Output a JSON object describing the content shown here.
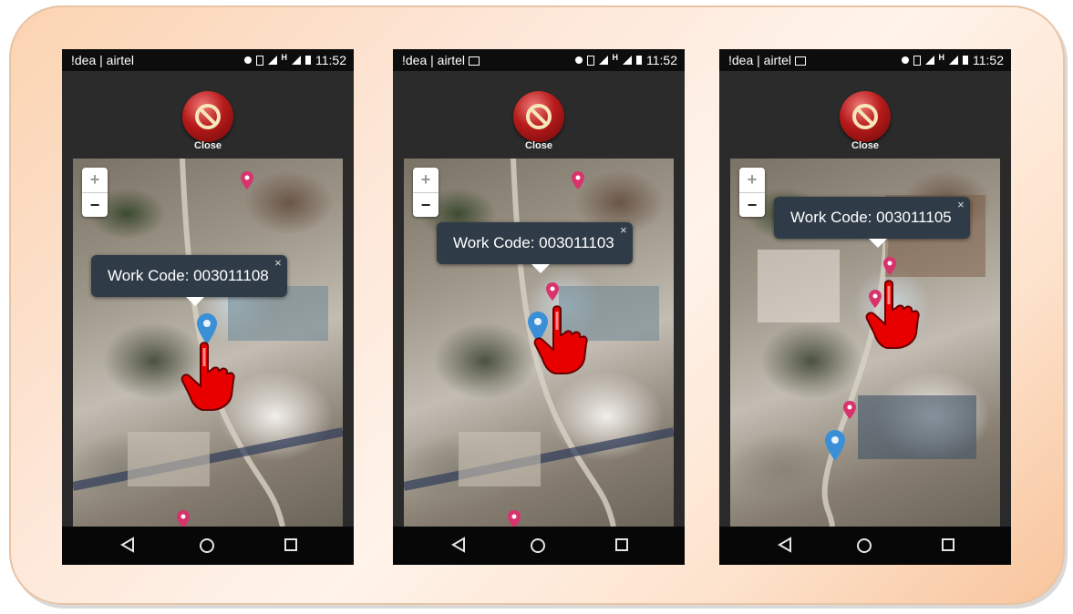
{
  "colors": {
    "panel_gradient": [
      "#fbd3b0",
      "#fff3ea",
      "#f8c49b"
    ],
    "popup_bg": "#2f3c48",
    "marker_blue": "#3a8fd6",
    "marker_pink": "#d8336c",
    "hand_red": "#e80000"
  },
  "screens": [
    {
      "status": {
        "carrier": "!dea | airtel",
        "time": "11:52",
        "icons": [
          "location-icon",
          "vibrate-icon",
          "signal-icon",
          "h-signal-icon",
          "battery-icon"
        ]
      },
      "close_label": "Close",
      "popup": {
        "text": "Work Code: 003011108",
        "close": "×"
      },
      "zoom": {
        "in": "+",
        "out": "−"
      }
    },
    {
      "status": {
        "carrier": "!dea | airtel",
        "time": "11:52",
        "icons": [
          "image-notification-icon",
          "location-icon",
          "vibrate-icon",
          "signal-icon",
          "h-signal-icon",
          "battery-icon"
        ]
      },
      "close_label": "Close",
      "popup": {
        "text": "Work Code: 003011103",
        "close": "×"
      },
      "zoom": {
        "in": "+",
        "out": "−"
      }
    },
    {
      "status": {
        "carrier": "!dea | airtel",
        "time": "11:52",
        "icons": [
          "image-notification-icon",
          "location-icon",
          "vibrate-icon",
          "signal-icon",
          "h-signal-icon",
          "battery-icon"
        ]
      },
      "close_label": "Close",
      "popup": {
        "text": "Work Code: 003011105",
        "close": "×"
      },
      "zoom": {
        "in": "+",
        "out": "−"
      }
    }
  ]
}
